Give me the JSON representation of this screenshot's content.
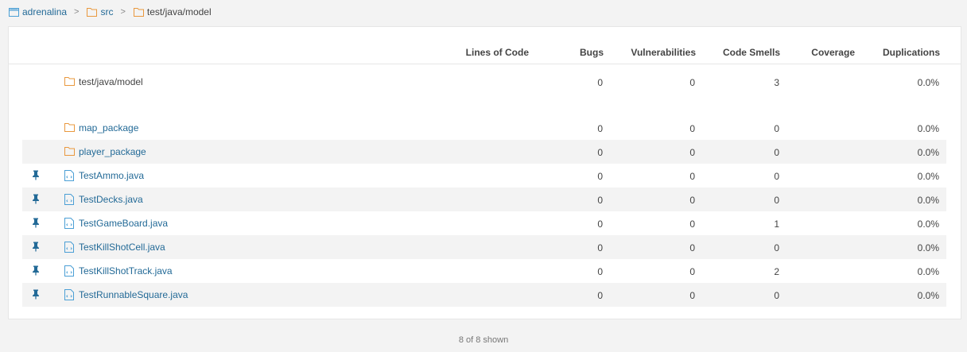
{
  "breadcrumb": {
    "project": "adrenalina",
    "src": "src",
    "current": "test/java/model"
  },
  "columns": {
    "loc": "Lines of Code",
    "bugs": "Bugs",
    "vulnerabilities": "Vulnerabilities",
    "code_smells": "Code Smells",
    "coverage": "Coverage",
    "duplications": "Duplications"
  },
  "base": {
    "name": "test/java/model",
    "bugs": "0",
    "vulnerabilities": "0",
    "code_smells": "3",
    "duplications": "0.0%"
  },
  "rows": [
    {
      "name": "map_package",
      "bugs": "0",
      "vulnerabilities": "0",
      "code_smells": "0",
      "duplications": "0.0%"
    },
    {
      "name": "player_package",
      "bugs": "0",
      "vulnerabilities": "0",
      "code_smells": "0",
      "duplications": "0.0%"
    },
    {
      "name": "TestAmmo.java",
      "bugs": "0",
      "vulnerabilities": "0",
      "code_smells": "0",
      "duplications": "0.0%"
    },
    {
      "name": "TestDecks.java",
      "bugs": "0",
      "vulnerabilities": "0",
      "code_smells": "0",
      "duplications": "0.0%"
    },
    {
      "name": "TestGameBoard.java",
      "bugs": "0",
      "vulnerabilities": "0",
      "code_smells": "1",
      "duplications": "0.0%"
    },
    {
      "name": "TestKillShotCell.java",
      "bugs": "0",
      "vulnerabilities": "0",
      "code_smells": "0",
      "duplications": "0.0%"
    },
    {
      "name": "TestKillShotTrack.java",
      "bugs": "0",
      "vulnerabilities": "0",
      "code_smells": "2",
      "duplications": "0.0%"
    },
    {
      "name": "TestRunnableSquare.java",
      "bugs": "0",
      "vulnerabilities": "0",
      "code_smells": "0",
      "duplications": "0.0%"
    }
  ],
  "footer": {
    "shown": "8 of 8 shown"
  },
  "colors": {
    "link": "#236a97",
    "folder": "#e9983e",
    "file": "#236a97",
    "pin": "#236a97"
  }
}
